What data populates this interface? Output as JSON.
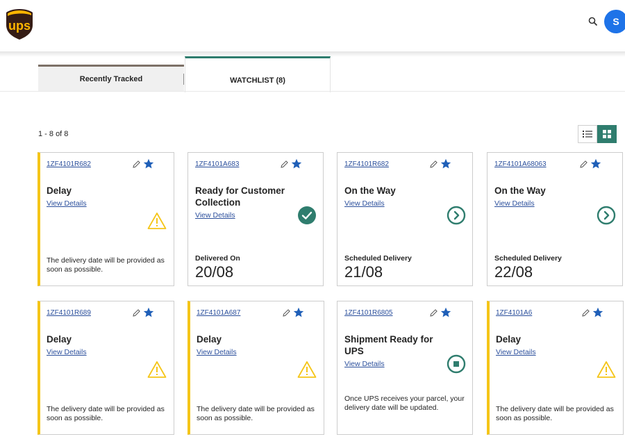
{
  "header": {
    "logo_text": "ups",
    "avatar_initial": "S"
  },
  "tabs": [
    {
      "label": "Recently Tracked",
      "active": false
    },
    {
      "label": "WATCHLIST (8)",
      "active": true
    }
  ],
  "results": {
    "count_text": "1 - 8 of 8",
    "view_modes": [
      "list-icon",
      "grid-icon"
    ],
    "active_view": "grid"
  },
  "colors": {
    "brand_brown": "#351c15",
    "brand_gold": "#ffb500",
    "accent_teal": "#2f7d6e",
    "link_blue": "#2b4f9c",
    "warning_yellow": "#f5c518",
    "avatar_blue": "#1e73e8"
  },
  "cards": [
    {
      "tracking": "1ZF4101R682",
      "status": "Delay",
      "details_label": "View Details",
      "icon": "warning-icon",
      "note": "The delivery date will be provided as soon as possible.",
      "date_label": "",
      "date_value": ""
    },
    {
      "tracking": "1ZF4101A683",
      "status": "Ready for Customer Collection",
      "details_label": "View Details",
      "icon": "check-circle-icon",
      "note": "",
      "date_label": "Delivered On",
      "date_value": "20/08"
    },
    {
      "tracking": "1ZF4101R682",
      "status": "On the Way",
      "details_label": "View Details",
      "icon": "arrow-circle-icon",
      "note": "",
      "date_label": "Scheduled Delivery",
      "date_value": "21/08"
    },
    {
      "tracking": "1ZF4101A68063",
      "status": "On the Way",
      "details_label": "View Details",
      "icon": "arrow-circle-icon",
      "note": "",
      "date_label": "Scheduled Delivery",
      "date_value": "22/08"
    },
    {
      "tracking": "1ZF4101R689",
      "status": "Delay",
      "details_label": "View Details",
      "icon": "warning-icon",
      "note": "The delivery date will be provided as soon as possible.",
      "date_label": "",
      "date_value": ""
    },
    {
      "tracking": "1ZF4101A687",
      "status": "Delay",
      "details_label": "View Details",
      "icon": "warning-icon",
      "note": "The delivery date will be provided as soon as possible.",
      "date_label": "",
      "date_value": ""
    },
    {
      "tracking": "1ZF4101R6805",
      "status": "Shipment Ready for UPS",
      "details_label": "View Details",
      "icon": "stop-circle-icon",
      "note": "Once UPS receives your parcel, your delivery date will be updated.",
      "date_label": "",
      "date_value": ""
    },
    {
      "tracking": "1ZF4101A6",
      "status": "Delay",
      "details_label": "View Details",
      "icon": "warning-icon",
      "note": "The delivery date will be provided as soon as possible.",
      "date_label": "",
      "date_value": ""
    }
  ]
}
